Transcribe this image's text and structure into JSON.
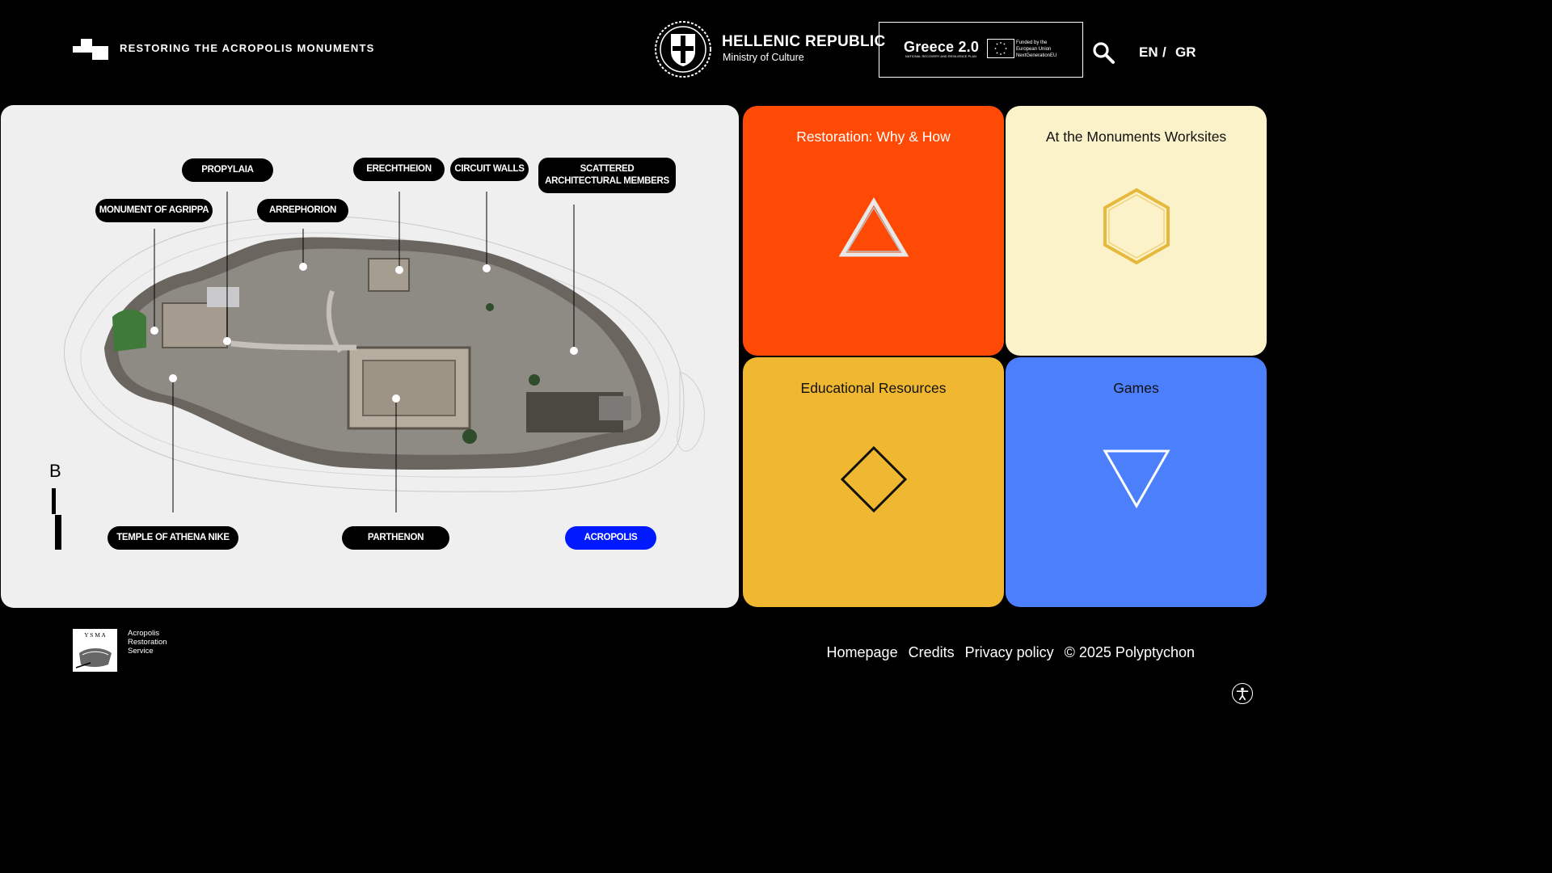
{
  "header": {
    "site_title": "RESTORING THE ACROPOLIS MONUMENTS",
    "ministry_title": "HELLENIC REPUBLIC",
    "ministry_subtitle": "Ministry of Culture",
    "greece20_title": "Greece 2.0",
    "greece20_subtitle": "NATIONAL RECOVERY AND RESILIENCE PLAN",
    "eu_line1": "Funded by the",
    "eu_line2": "European Union",
    "eu_line3": "NextGenerationEU",
    "search_icon": "search-icon",
    "lang_en": "EN",
    "lang_sep": "/",
    "lang_gr": "GR"
  },
  "map": {
    "labels": {
      "propylaia": "PROPYLAIA",
      "erechtheion": "ERECHTHEION",
      "circuit_walls": "CIRCUIT WALLS",
      "scattered_line1": "SCATTERED",
      "scattered_line2": "ARCHITECTURAL MEMBERS",
      "monument_of_agrippa": "MONUMENT OF AGRIPPA",
      "arrephorion": "ARREPHORION",
      "temple_of_athena_nike": "TEMPLE OF ATHENA NIKE",
      "parthenon": "PARTHENON",
      "acropolis": "ACROPOLIS"
    },
    "compass_letter": "B",
    "active_color": "#0019ff"
  },
  "tiles": [
    {
      "label": "Restoration: Why & How",
      "icon": "triangle-up-icon",
      "color": "#ff4a05"
    },
    {
      "label": "At the Monuments Worksites",
      "icon": "hexagon-icon",
      "color": "#fbf2c9"
    },
    {
      "label": "Educational Resources",
      "icon": "diamond-icon",
      "color": "#f0b731"
    },
    {
      "label": "Games",
      "icon": "triangle-down-icon",
      "color": "#4b7ffc"
    }
  ],
  "footer": {
    "ysma_letters": "Y S M A",
    "ysma_line1": "Acropolis",
    "ysma_line2": "Restoration",
    "ysma_line3": "Service",
    "links": [
      "Homepage",
      "Credits",
      "Privacy policy",
      "© 2025 Polyptychon"
    ],
    "accessibility_icon": "accessibility-icon"
  }
}
